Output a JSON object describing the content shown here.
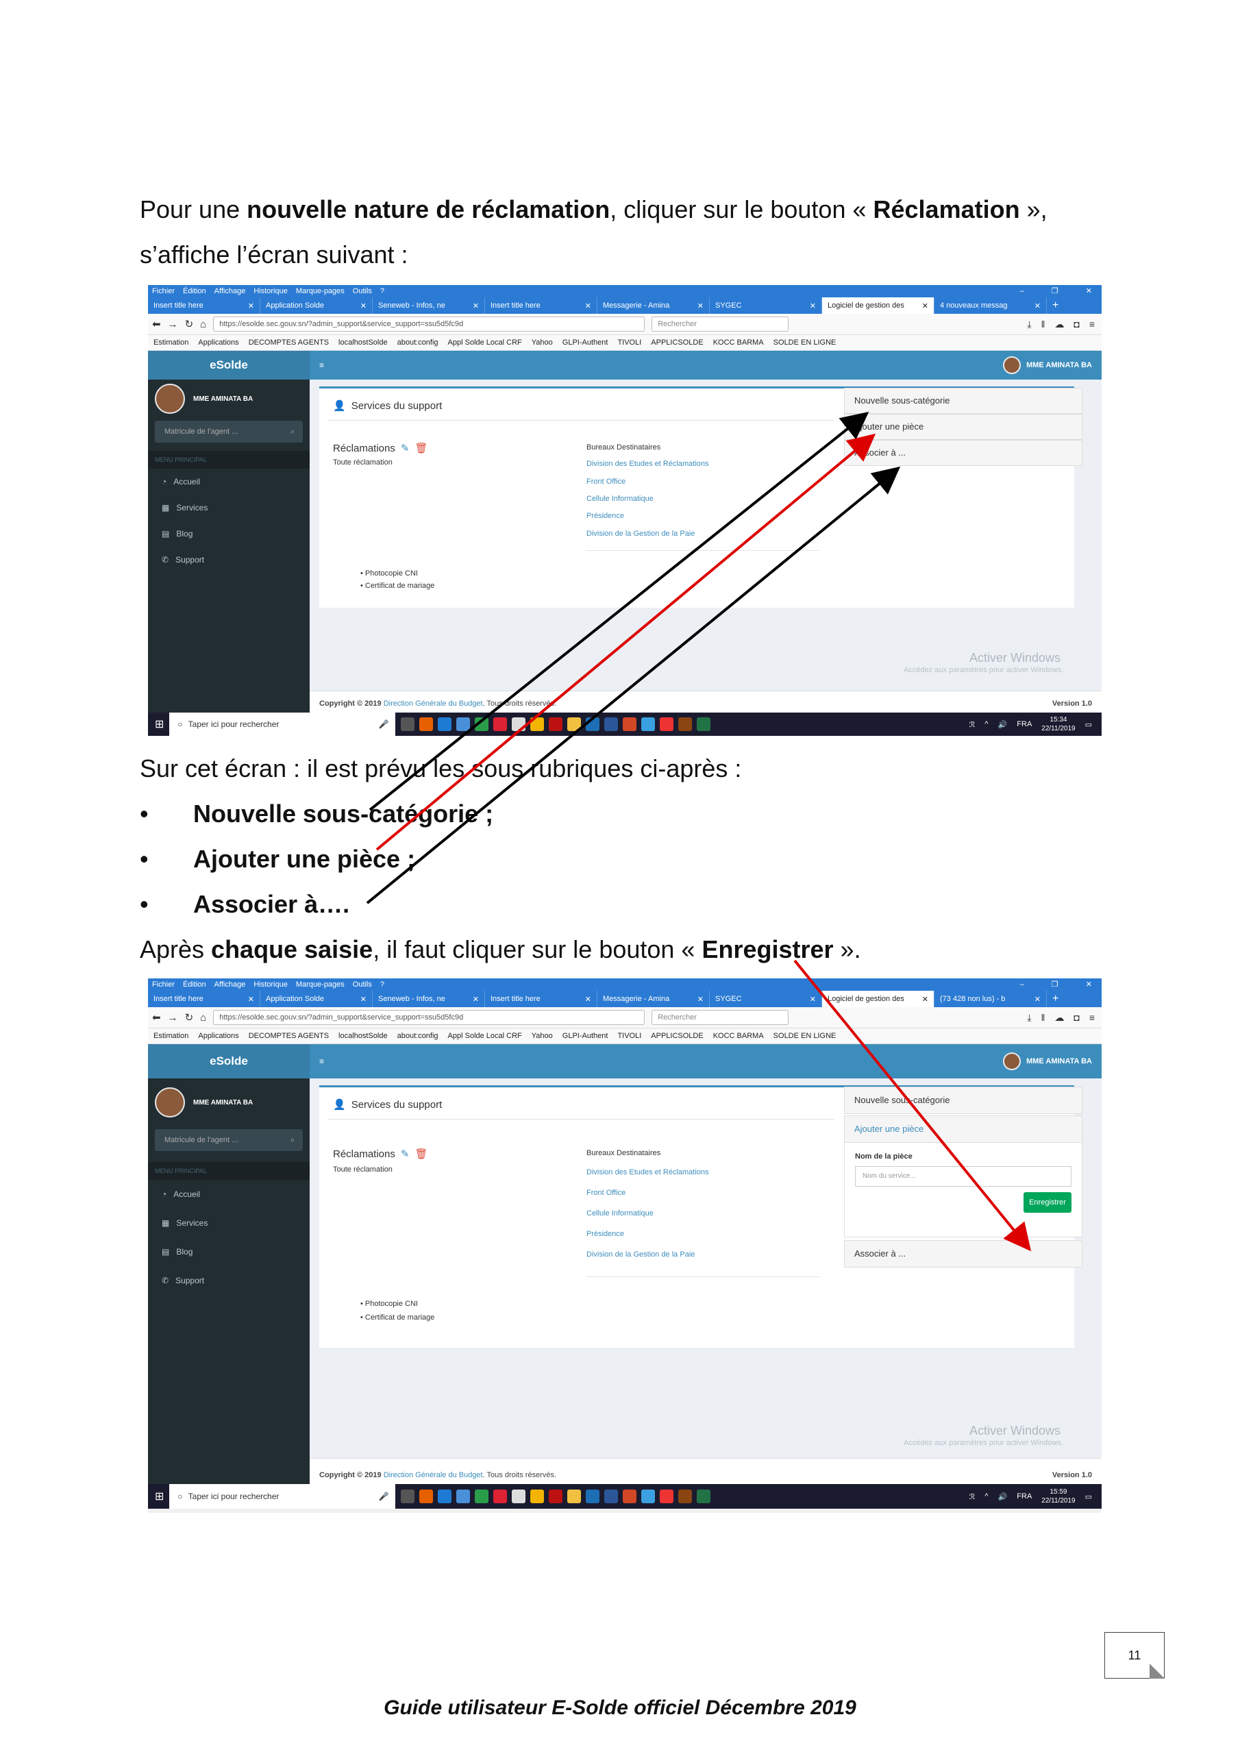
{
  "intro": {
    "part1": "Pour une ",
    "bold1": "nouvelle nature de réclamation",
    "part2": ", cliquer sur le bouton « ",
    "bold2": "Réclamation",
    "part3": " »,",
    "line2": "s’affiche l’écran suivant :"
  },
  "middle": {
    "text": "Sur cet écran : il est prévu les sous rubriques ci-après :",
    "bullets": [
      "Nouvelle sous-catégorie ;",
      "Ajouter une pièce ;",
      "Associer à…."
    ],
    "after1": "Après ",
    "afterBold1": "chaque saisie",
    "after2": ", il faut cliquer sur le bouton « ",
    "afterBold2": "Enregistrer",
    "after3": " »."
  },
  "browser": {
    "menu": [
      "Fichier",
      "Édition",
      "Affichage",
      "Historique",
      "Marque-pages",
      "Outils",
      "?"
    ],
    "tabs": [
      "Insert title here",
      "Application Solde",
      "Seneweb - Infos, ne",
      "Insert title here",
      "Messagerie - Amina",
      "SYGEC",
      "Logiciel de gestion des",
      "4 nouveaux messag"
    ],
    "tabs2_last": "(73 428 non lus) - b",
    "url": "https://esolde.sec.gouv.sn/?admin_support&service_support=ssu5d5fc9d",
    "search_placeholder": "Rechercher",
    "bookmarks": [
      "Estimation",
      "Applications",
      "DECOMPTES AGENTS",
      "localhostSolde",
      "about:config",
      "Appl Solde Local CRF",
      "Yahoo",
      "GLPI-Authent",
      "TIVOLI",
      "APPLICSOLDE",
      "KOCC BARMA",
      "SOLDE EN LIGNE"
    ]
  },
  "app": {
    "brand": "eSolde",
    "user": "MME AMINATA BA",
    "matricule_placeholder": "Matricule de l'agent ...",
    "menu_header": "MENU PRINCIPAL",
    "menu": [
      "Accueil",
      "Services",
      "Blog",
      "Support"
    ],
    "box_title": "Services du support",
    "reclamations": "Réclamations",
    "toute": "Toute réclamation",
    "bureaux_title": "Bureaux Destinataires",
    "bureaux": [
      "Division des Etudes et Réclamations",
      "Front Office",
      "Cellule Informatique",
      "Présidence",
      "Division de la Gestion de la Paie"
    ],
    "pieces": [
      "Photocopie CNI",
      "Certificat de mariage"
    ],
    "acc": [
      "Nouvelle sous-catégorie",
      "Ajouter une pièce",
      "Associer à ..."
    ],
    "nom_piece": "Nom de la pièce",
    "nom_placeholder": "Nom du service...",
    "enregistrer": "Enregistrer",
    "copyright_pre": "Copyright © 2019 ",
    "copyright_link": "Direction Générale du Budget",
    "copyright_post": ". Tous droits réservés.",
    "version": "Version 1.0",
    "activate": "Activer Windows",
    "activate_sub": "Accédez aux paramètres pour activer Windows.",
    "taskbar_search": "Taper ici pour rechercher",
    "lang": "FRA",
    "time1": "15:34",
    "time2": "15:59",
    "date": "22/11/2019"
  },
  "page_number": "11",
  "footer": "Guide utilisateur E-Solde officiel Décembre 2019"
}
